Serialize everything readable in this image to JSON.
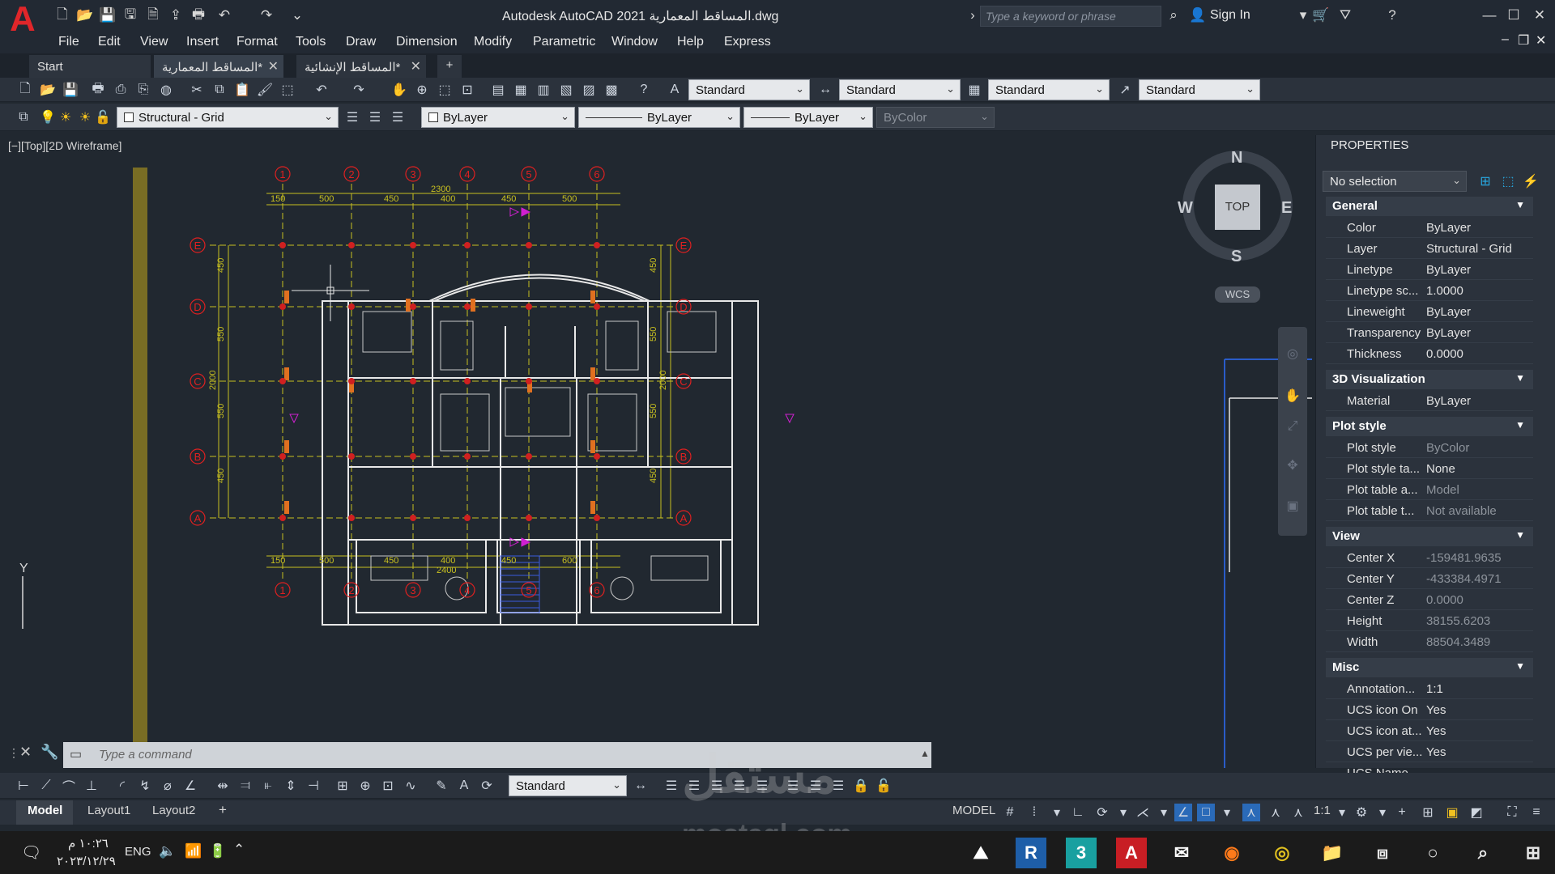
{
  "title_bar": {
    "window_title": "Autodesk AutoCAD 2021   المساقط المعمارية.dwg",
    "search_placeholder": "Type a keyword or phrase",
    "sign_in": "Sign In"
  },
  "menu": [
    "File",
    "Edit",
    "View",
    "Insert",
    "Format",
    "Tools",
    "Draw",
    "Dimension",
    "Modify",
    "Parametric",
    "Window",
    "Help",
    "Express"
  ],
  "tabs": [
    {
      "label": "Start"
    },
    {
      "label": "المساقط المعمارية*"
    },
    {
      "label": "المساقط الإنشائية*"
    }
  ],
  "styles_toolbar": {
    "text_style": "Standard",
    "dim_style": "Standard",
    "table_style": "Standard",
    "mleader_style": "Standard"
  },
  "layers_toolbar": {
    "layer": "Structural - Grid",
    "color": "ByLayer",
    "linetype": "ByLayer",
    "lineweight": "ByLayer",
    "plot_style": "ByColor"
  },
  "viewport": {
    "label": "[−][Top][2D Wireframe]",
    "viewcube_top": "TOP",
    "compass": {
      "n": "N",
      "s": "S",
      "e": "E",
      "w": "W"
    },
    "wcs": "WCS"
  },
  "drawing": {
    "grid_columns": [
      "1",
      "2",
      "3",
      "4",
      "5",
      "6"
    ],
    "grid_rows": [
      "E",
      "D",
      "C",
      "B",
      "A"
    ],
    "dims_top": [
      "150",
      "500",
      "450",
      "400",
      "450",
      "500"
    ],
    "dims_top_total": "2300",
    "dims_bottom": [
      "150",
      "500",
      "450",
      "400",
      "450",
      "600"
    ],
    "dims_bottom_total": "2400",
    "dims_side": [
      "450",
      "550",
      "550",
      "450"
    ],
    "dims_side_total": "2000"
  },
  "properties": {
    "header": "PROPERTIES",
    "selection": "No selection",
    "sections": [
      {
        "title": "General",
        "rows": [
          {
            "k": "Color",
            "v": "ByLayer"
          },
          {
            "k": "Layer",
            "v": "Structural - Grid"
          },
          {
            "k": "Linetype",
            "v": "ByLayer"
          },
          {
            "k": "Linetype sc...",
            "v": "1.0000"
          },
          {
            "k": "Lineweight",
            "v": "ByLayer"
          },
          {
            "k": "Transparency",
            "v": "ByLayer"
          },
          {
            "k": "Thickness",
            "v": "0.0000"
          }
        ]
      },
      {
        "title": "3D Visualization",
        "rows": [
          {
            "k": "Material",
            "v": "ByLayer"
          }
        ]
      },
      {
        "title": "Plot style",
        "rows": [
          {
            "k": "Plot style",
            "v": "ByColor"
          },
          {
            "k": "Plot style ta...",
            "v": "None"
          },
          {
            "k": "Plot table a...",
            "v": "Model"
          },
          {
            "k": "Plot table t...",
            "v": "Not available"
          }
        ]
      },
      {
        "title": "View",
        "rows": [
          {
            "k": "Center X",
            "v": "-159481.9635"
          },
          {
            "k": "Center Y",
            "v": "-433384.4971"
          },
          {
            "k": "Center Z",
            "v": "0.0000"
          },
          {
            "k": "Height",
            "v": "38155.6203"
          },
          {
            "k": "Width",
            "v": "88504.3489"
          }
        ]
      },
      {
        "title": "Misc",
        "rows": [
          {
            "k": "Annotation...",
            "v": "1:1"
          },
          {
            "k": "UCS icon On",
            "v": "Yes"
          },
          {
            "k": "UCS icon at...",
            "v": "Yes"
          },
          {
            "k": "UCS per vie...",
            "v": "Yes"
          },
          {
            "k": "UCS Name",
            "v": ""
          }
        ]
      }
    ]
  },
  "command_line": {
    "placeholder": "Type a command"
  },
  "bottom_toolbar": {
    "dim_style": "Standard"
  },
  "layout_tabs": [
    "Model",
    "Layout1",
    "Layout2"
  ],
  "status_bar": {
    "mode": "MODEL",
    "scale": "1:1"
  },
  "taskbar": {
    "time": "١٠:٢٦ م",
    "date": "٢٠٢٣/١٢/٢٩",
    "lang": "ENG"
  },
  "watermark": {
    "brand": "مستقل",
    "site": "mostaql.com"
  },
  "colors": {
    "bg": "#212830",
    "grid": "#e02020",
    "dim": "#c8c020",
    "wall": "#ffffff",
    "column": "#e07020",
    "accent": "#e0262a"
  }
}
